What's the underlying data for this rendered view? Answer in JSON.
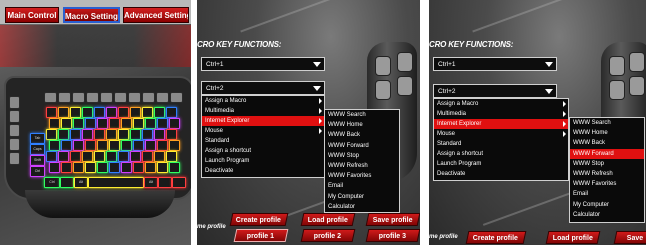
{
  "panel1": {
    "tabs": [
      {
        "label": "Main Control",
        "active": false
      },
      {
        "label": "Macro Settings",
        "active": true
      },
      {
        "label": "Advanced Settings",
        "active": false
      }
    ],
    "keyboard": {
      "row1": [
        "",
        "",
        "",
        "",
        "",
        "",
        "",
        "",
        "",
        ""
      ],
      "bottom_keys": [
        "Ctrl",
        "",
        "Alt",
        "",
        "",
        "Alt",
        "",
        ""
      ],
      "side_keys": [
        "Tab",
        "Caps Lock",
        "Shift",
        "Ctrl"
      ]
    }
  },
  "panel2": {
    "section_title": "CRO KEY FUNCTIONS:",
    "select1_value": "Ctrl+1",
    "select2_value": "Ctrl+2",
    "menu_items": [
      {
        "label": "Assign a Macro",
        "has_sub": true,
        "highlighted": false
      },
      {
        "label": "Multimedia",
        "has_sub": true,
        "highlighted": false
      },
      {
        "label": "Internet Explorer",
        "has_sub": true,
        "highlighted": true
      },
      {
        "label": "Mouse",
        "has_sub": true,
        "highlighted": false
      },
      {
        "label": "Standard",
        "has_sub": false,
        "highlighted": false
      },
      {
        "label": "Assign a shortcut",
        "has_sub": false,
        "highlighted": false
      },
      {
        "label": "Launch Program",
        "has_sub": false,
        "highlighted": false
      },
      {
        "label": "Deactivate",
        "has_sub": false,
        "highlighted": false
      }
    ],
    "submenu_items": [
      {
        "label": "WWW Search",
        "highlighted": false
      },
      {
        "label": "WWW Home",
        "highlighted": false
      },
      {
        "label": "WWW Back",
        "highlighted": false
      },
      {
        "label": "WWW Forward",
        "highlighted": false
      },
      {
        "label": "WWW Stop",
        "highlighted": false
      },
      {
        "label": "WWW Refresh",
        "highlighted": false
      },
      {
        "label": "WWW Favorites",
        "highlighted": false
      },
      {
        "label": "Email",
        "highlighted": false
      },
      {
        "label": "My Computer",
        "highlighted": false
      },
      {
        "label": "Calculator",
        "highlighted": false
      }
    ],
    "edge_label": "me profile",
    "buttons": {
      "create_profile": "Create profile",
      "load_profile": "Load profile",
      "save_profile": "Save profile",
      "profile1": "profile 1",
      "profile2": "profile 2",
      "profile3": "profile 3"
    }
  },
  "panel3": {
    "section_title": "CRO KEY FUNCTIONS:",
    "select1_value": "Ctrl+1",
    "select2_value": "Ctrl+2",
    "menu_items": [
      {
        "label": "Assign a Macro",
        "has_sub": true,
        "highlighted": false
      },
      {
        "label": "Multimedia",
        "has_sub": true,
        "highlighted": false
      },
      {
        "label": "Internet Explorer",
        "has_sub": true,
        "highlighted": true
      },
      {
        "label": "Mouse",
        "has_sub": true,
        "highlighted": false
      },
      {
        "label": "Standard",
        "has_sub": false,
        "highlighted": false
      },
      {
        "label": "Assign a shortcut",
        "has_sub": false,
        "highlighted": false
      },
      {
        "label": "Launch Program",
        "has_sub": false,
        "highlighted": false
      },
      {
        "label": "Deactivate",
        "has_sub": false,
        "highlighted": false
      }
    ],
    "submenu_items": [
      {
        "label": "WWW Search",
        "highlighted": false
      },
      {
        "label": "WWW Home",
        "highlighted": false
      },
      {
        "label": "WWW Back",
        "highlighted": false
      },
      {
        "label": "WWW Forward",
        "highlighted": true
      },
      {
        "label": "WWW Stop",
        "highlighted": false
      },
      {
        "label": "WWW Refresh",
        "highlighted": false
      },
      {
        "label": "WWW Favorites",
        "highlighted": false
      },
      {
        "label": "Email",
        "highlighted": false
      },
      {
        "label": "My Computer",
        "highlighted": false
      },
      {
        "label": "Calculator",
        "highlighted": false
      }
    ],
    "edge_label": "me profile",
    "buttons": {
      "create_profile": "Create profile",
      "load_profile": "Load profile",
      "save_profile": "Save"
    }
  },
  "colors": {
    "accent_red": "#e01010",
    "active_tab_border": "#2a5fd0"
  }
}
